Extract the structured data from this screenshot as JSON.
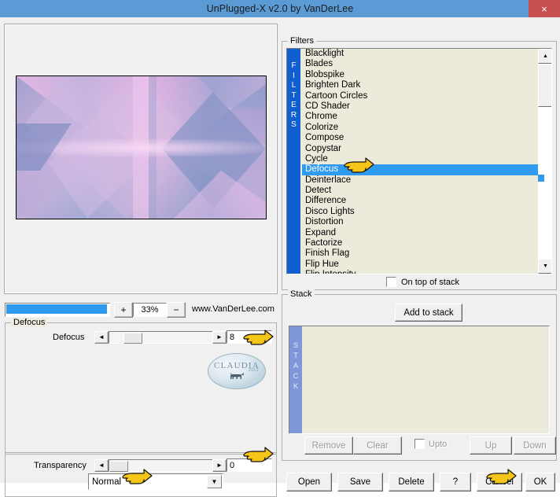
{
  "window": {
    "title": "UnPlugged-X v2.0 by VanDerLee",
    "close_label": "×",
    "titlebar_color": "#5b9bd5",
    "close_color": "#c75050"
  },
  "preview": {
    "zoom_decrease_label": "−",
    "zoom_increase_label": "+",
    "zoom_value": "33%",
    "website": "www.VanDerLee.com"
  },
  "defocus_group": {
    "legend": "Defocus",
    "slider_label": "Defocus",
    "left_arrow": "◄",
    "right_arrow": "►",
    "value": "8",
    "watermark": {
      "text": "CLAUDIA",
      "sub": "2012",
      "dog": "ὁ5"
    }
  },
  "transparency_group": {
    "label": "Transparency",
    "left_arrow": "◄",
    "right_arrow": "►",
    "value": "0",
    "blend_mode": "Normal",
    "dropdown_arrow": "▼"
  },
  "filters": {
    "legend": "Filters",
    "sidebar_label": "FILTERS",
    "selected": "Defocus",
    "items": [
      "Blacklight",
      "Blades",
      "Blobspike",
      "Brighten Dark",
      "Cartoon Circles",
      "CD Shader",
      "Chrome",
      "Colorize",
      "Compose",
      "Copystar",
      "Cycle",
      "Defocus",
      "Deinterlace",
      "Detect",
      "Difference",
      "Disco Lights",
      "Distortion",
      "Expand",
      "Factorize",
      "Finish Flag",
      "Flip Hue",
      "Flip Intensity"
    ],
    "scroll_up": "▲",
    "scroll_down": "▼",
    "on_top_of_stack": "On top of stack",
    "on_top_checked": false,
    "selection_color": "#2e9bf0",
    "sidebar_color": "#0f5fd1",
    "list_background": "#eceadb"
  },
  "stack": {
    "legend": "Stack",
    "sidebar_label": "STACK",
    "add_button": "Add to stack",
    "items": [],
    "buttons": [
      {
        "label": "Remove",
        "enabled": false
      },
      {
        "label": "Clear",
        "enabled": false
      },
      {
        "label": "Up",
        "enabled": false
      },
      {
        "label": "Down",
        "enabled": false
      }
    ],
    "upto_label": "Upto",
    "upto_checked": false,
    "sidebar_color": "#7f96d8"
  },
  "bottom_buttons": [
    {
      "label": "Open"
    },
    {
      "label": "Save"
    },
    {
      "label": "Delete"
    },
    {
      "label": "?"
    },
    {
      "label": "Cancel"
    },
    {
      "label": "OK"
    }
  ]
}
